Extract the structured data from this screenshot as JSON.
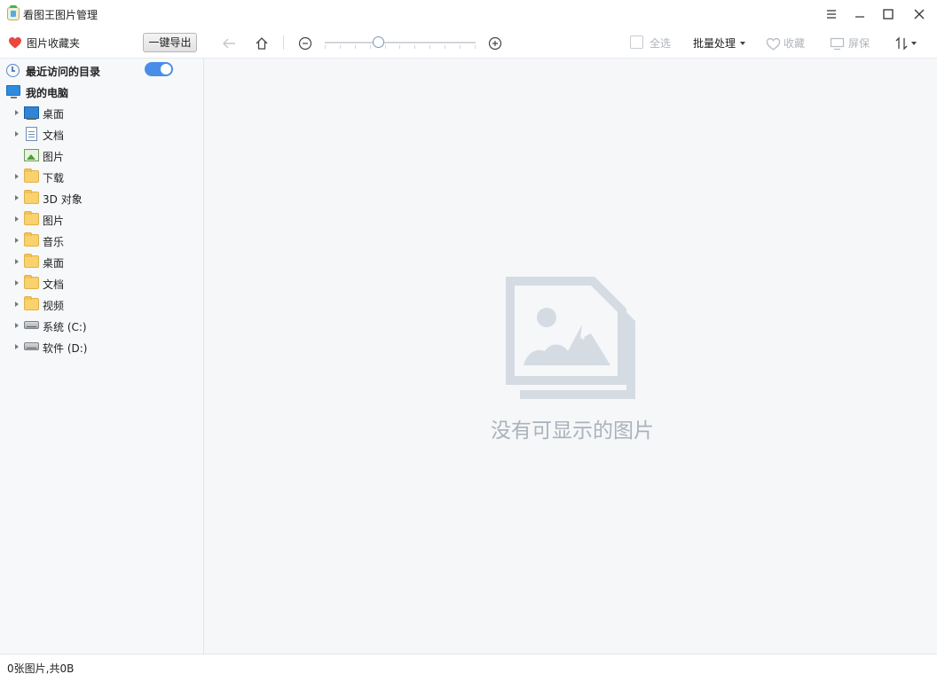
{
  "window": {
    "title": "看图王图片管理"
  },
  "toolbar": {
    "favorites_label": "图片收藏夹",
    "export_label": "一键导出",
    "zoom_level": 0.35,
    "select_all_label": "全选",
    "batch_label": "批量处理",
    "favorite_label": "收藏",
    "screen_label": "屏保"
  },
  "sidebar": {
    "recent_label": "最近访问的目录",
    "recent_enabled": true,
    "computer_label": "我的电脑",
    "items": [
      {
        "label": "桌面",
        "icon": "desktop-icon",
        "expandable": true
      },
      {
        "label": "文档",
        "icon": "document-icon",
        "expandable": true
      },
      {
        "label": "图片",
        "icon": "picture-icon",
        "expandable": false
      },
      {
        "label": "下载",
        "icon": "folder-icon",
        "expandable": true
      },
      {
        "label": "3D 对象",
        "icon": "folder-icon",
        "expandable": true
      },
      {
        "label": "图片",
        "icon": "folder-icon",
        "expandable": true
      },
      {
        "label": "音乐",
        "icon": "folder-icon",
        "expandable": true
      },
      {
        "label": "桌面",
        "icon": "folder-icon",
        "expandable": true
      },
      {
        "label": "文档",
        "icon": "folder-icon",
        "expandable": true
      },
      {
        "label": "视频",
        "icon": "folder-icon",
        "expandable": true
      },
      {
        "label": "系统 (C:)",
        "icon": "drive-icon",
        "expandable": true
      },
      {
        "label": "软件 (D:)",
        "icon": "drive-icon",
        "expandable": true
      }
    ]
  },
  "main": {
    "empty_message": "没有可显示的图片"
  },
  "status": {
    "text": "0张图片,共0B"
  },
  "colors": {
    "accent": "#4a8de8",
    "heart": "#e8483f",
    "disabled_text": "#b0b4ba",
    "empty_illustration": "#d5dbe2"
  }
}
